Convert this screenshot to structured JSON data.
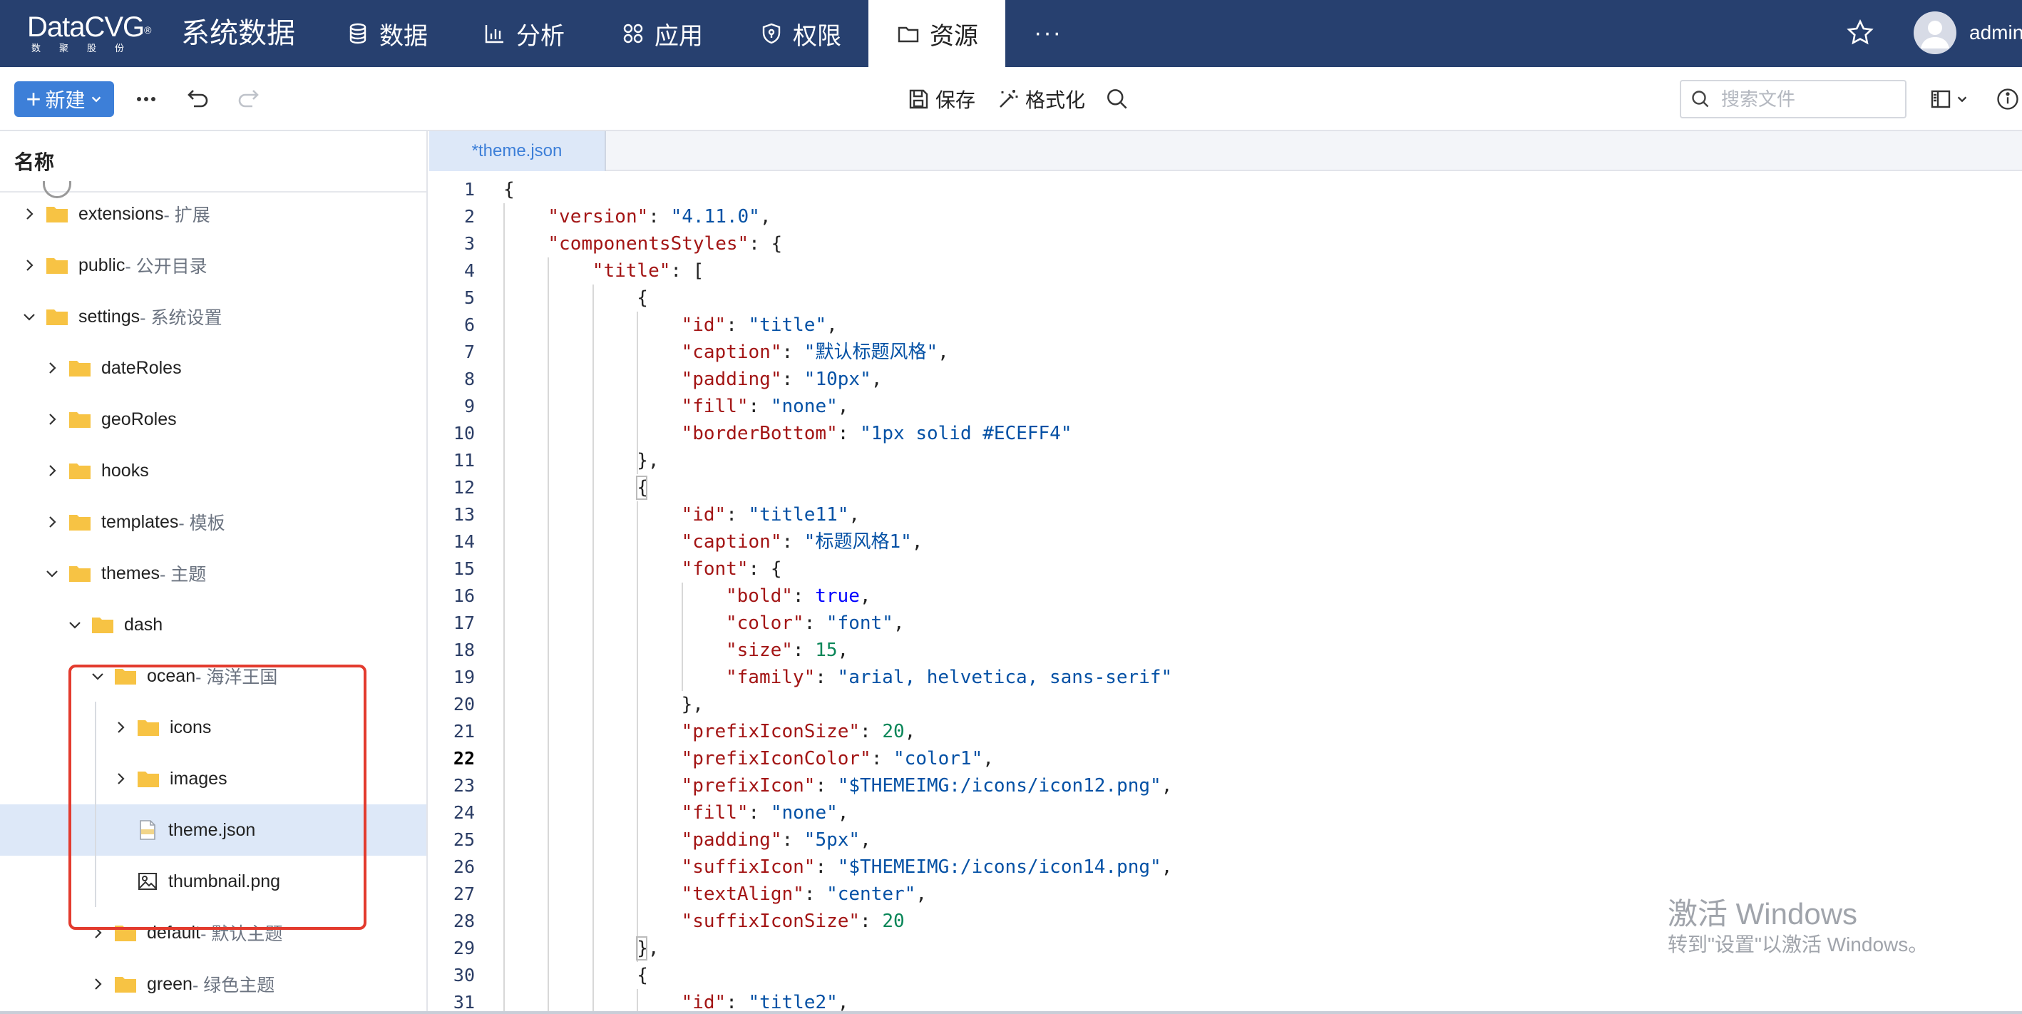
{
  "brand": {
    "logo_text": "DataCVG",
    "logo_mark": "®",
    "logo_subtitle": "数聚股份",
    "app_title": "系统数据"
  },
  "nav": {
    "items": [
      {
        "label": "数据",
        "icon": "database-icon"
      },
      {
        "label": "分析",
        "icon": "bar-chart-icon"
      },
      {
        "label": "应用",
        "icon": "apps-grid-icon"
      },
      {
        "label": "权限",
        "icon": "shield-icon"
      },
      {
        "label": "资源",
        "icon": "folder-icon",
        "active": true
      }
    ],
    "more": "···",
    "user_name": "admin"
  },
  "toolbar": {
    "new_label": "新建",
    "save_label": "保存",
    "format_label": "格式化",
    "search_placeholder": "搜索文件"
  },
  "sidebar": {
    "header": "名称",
    "rows": [
      {
        "name": "extensions",
        "desc": " - 扩展",
        "type": "folder",
        "expanded": false
      },
      {
        "name": "public",
        "desc": " - 公开目录",
        "type": "folder",
        "expanded": false
      },
      {
        "name": "settings",
        "desc": " - 系统设置",
        "type": "folder",
        "expanded": true
      },
      {
        "name": "dateRoles",
        "desc": "",
        "type": "folder",
        "expanded": false
      },
      {
        "name": "geoRoles",
        "desc": "",
        "type": "folder",
        "expanded": false
      },
      {
        "name": "hooks",
        "desc": "",
        "type": "folder",
        "expanded": false
      },
      {
        "name": "templates",
        "desc": " - 模板",
        "type": "folder",
        "expanded": false
      },
      {
        "name": "themes",
        "desc": " - 主题",
        "type": "folder",
        "expanded": true
      },
      {
        "name": "dash",
        "desc": "",
        "type": "folder",
        "expanded": true
      },
      {
        "name": "ocean",
        "desc": " - 海洋王国",
        "type": "folder",
        "expanded": true
      },
      {
        "name": "icons",
        "desc": "",
        "type": "folder",
        "expanded": false
      },
      {
        "name": "images",
        "desc": "",
        "type": "folder",
        "expanded": false
      },
      {
        "name": "theme.json",
        "desc": "",
        "type": "json",
        "selected": true
      },
      {
        "name": "thumbnail.png",
        "desc": "",
        "type": "image"
      },
      {
        "name": "default",
        "desc": " - 默认主题",
        "type": "folder",
        "expanded": false
      },
      {
        "name": "green",
        "desc": " - 绿色主题",
        "type": "folder",
        "expanded": false
      }
    ]
  },
  "editor": {
    "tab_label": "*theme.json",
    "current_line": 22,
    "lines": [
      [
        [
          "p",
          "{"
        ]
      ],
      [
        [
          "k",
          "\"version\""
        ],
        [
          "p",
          ": "
        ],
        [
          "s",
          "\"4.11.0\""
        ],
        [
          "p",
          ","
        ]
      ],
      [
        [
          "k",
          "\"componentsStyles\""
        ],
        [
          "p",
          ": {"
        ]
      ],
      [
        [
          "k",
          "\"title\""
        ],
        [
          "p",
          ": ["
        ]
      ],
      [
        [
          "p",
          "{"
        ]
      ],
      [
        [
          "k",
          "\"id\""
        ],
        [
          "p",
          ": "
        ],
        [
          "s",
          "\"title\""
        ],
        [
          "p",
          ","
        ]
      ],
      [
        [
          "k",
          "\"caption\""
        ],
        [
          "p",
          ": "
        ],
        [
          "s",
          "\"默认标题风格\""
        ],
        [
          "p",
          ","
        ]
      ],
      [
        [
          "k",
          "\"padding\""
        ],
        [
          "p",
          ": "
        ],
        [
          "s",
          "\"10px\""
        ],
        [
          "p",
          ","
        ]
      ],
      [
        [
          "k",
          "\"fill\""
        ],
        [
          "p",
          ": "
        ],
        [
          "s",
          "\"none\""
        ],
        [
          "p",
          ","
        ]
      ],
      [
        [
          "k",
          "\"borderBottom\""
        ],
        [
          "p",
          ": "
        ],
        [
          "s",
          "\"1px solid #ECEFF4\""
        ]
      ],
      [
        [
          "p",
          "},"
        ]
      ],
      [
        [
          "p",
          "{"
        ]
      ],
      [
        [
          "k",
          "\"id\""
        ],
        [
          "p",
          ": "
        ],
        [
          "s",
          "\"title11\""
        ],
        [
          "p",
          ","
        ]
      ],
      [
        [
          "k",
          "\"caption\""
        ],
        [
          "p",
          ": "
        ],
        [
          "s",
          "\"标题风格1\""
        ],
        [
          "p",
          ","
        ]
      ],
      [
        [
          "k",
          "\"font\""
        ],
        [
          "p",
          ": {"
        ]
      ],
      [
        [
          "k",
          "\"bold\""
        ],
        [
          "p",
          ": "
        ],
        [
          "b",
          "true"
        ],
        [
          "p",
          ","
        ]
      ],
      [
        [
          "k",
          "\"color\""
        ],
        [
          "p",
          ": "
        ],
        [
          "s",
          "\"font\""
        ],
        [
          "p",
          ","
        ]
      ],
      [
        [
          "k",
          "\"size\""
        ],
        [
          "p",
          ": "
        ],
        [
          "n",
          "15"
        ],
        [
          "p",
          ","
        ]
      ],
      [
        [
          "k",
          "\"family\""
        ],
        [
          "p",
          ": "
        ],
        [
          "s",
          "\"arial, helvetica, sans-serif\""
        ]
      ],
      [
        [
          "p",
          "},"
        ]
      ],
      [
        [
          "k",
          "\"prefixIconSize\""
        ],
        [
          "p",
          ": "
        ],
        [
          "n",
          "20"
        ],
        [
          "p",
          ","
        ]
      ],
      [
        [
          "k",
          "\"prefixIconColor\""
        ],
        [
          "p",
          ": "
        ],
        [
          "s",
          "\"color1\""
        ],
        [
          "p",
          ","
        ]
      ],
      [
        [
          "k",
          "\"prefixIcon\""
        ],
        [
          "p",
          ": "
        ],
        [
          "s",
          "\"$THEMEIMG:/icons/icon12.png\""
        ],
        [
          "p",
          ","
        ]
      ],
      [
        [
          "k",
          "\"fill\""
        ],
        [
          "p",
          ": "
        ],
        [
          "s",
          "\"none\""
        ],
        [
          "p",
          ","
        ]
      ],
      [
        [
          "k",
          "\"padding\""
        ],
        [
          "p",
          ": "
        ],
        [
          "s",
          "\"5px\""
        ],
        [
          "p",
          ","
        ]
      ],
      [
        [
          "k",
          "\"suffixIcon\""
        ],
        [
          "p",
          ": "
        ],
        [
          "s",
          "\"$THEMEIMG:/icons/icon14.png\""
        ],
        [
          "p",
          ","
        ]
      ],
      [
        [
          "k",
          "\"textAlign\""
        ],
        [
          "p",
          ": "
        ],
        [
          "s",
          "\"center\""
        ],
        [
          "p",
          ","
        ]
      ],
      [
        [
          "k",
          "\"suffixIconSize\""
        ],
        [
          "p",
          ": "
        ],
        [
          "n",
          "20"
        ]
      ],
      [
        [
          "p",
          "},"
        ]
      ],
      [
        [
          "p",
          "{"
        ]
      ],
      [
        [
          "k",
          "\"id\""
        ],
        [
          "p",
          ": "
        ],
        [
          "s",
          "\"title2\""
        ],
        [
          "p",
          ","
        ]
      ]
    ]
  },
  "watermark": {
    "title": "激活 Windows",
    "subtitle": "转到\"设置\"以激活 Windows。"
  },
  "colors": {
    "topbar": "#27406f",
    "accent": "#3d7fd8",
    "folder": "#f7c344",
    "highlight_frame": "#e33b2e"
  }
}
